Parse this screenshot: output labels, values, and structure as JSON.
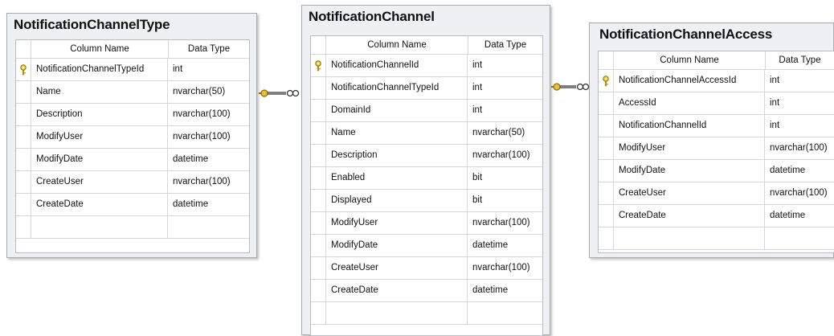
{
  "headers": {
    "column_name": "Column Name",
    "data_type": "Data Type"
  },
  "tables": [
    {
      "name": "NotificationChannelType",
      "columns": [
        {
          "name": "NotificationChannelTypeId",
          "type": "int",
          "key": true
        },
        {
          "name": "Name",
          "type": "nvarchar(50)",
          "key": false
        },
        {
          "name": "Description",
          "type": "nvarchar(100)",
          "key": false
        },
        {
          "name": "ModifyUser",
          "type": "nvarchar(100)",
          "key": false
        },
        {
          "name": "ModifyDate",
          "type": "datetime",
          "key": false
        },
        {
          "name": "CreateUser",
          "type": "nvarchar(100)",
          "key": false
        },
        {
          "name": "CreateDate",
          "type": "datetime",
          "key": false
        }
      ]
    },
    {
      "name": "NotificationChannel",
      "columns": [
        {
          "name": "NotificationChannelId",
          "type": "int",
          "key": true
        },
        {
          "name": "NotificationChannelTypeId",
          "type": "int",
          "key": false
        },
        {
          "name": "DomainId",
          "type": "int",
          "key": false
        },
        {
          "name": "Name",
          "type": "nvarchar(50)",
          "key": false
        },
        {
          "name": "Description",
          "type": "nvarchar(100)",
          "key": false
        },
        {
          "name": "Enabled",
          "type": "bit",
          "key": false
        },
        {
          "name": "Displayed",
          "type": "bit",
          "key": false
        },
        {
          "name": "ModifyUser",
          "type": "nvarchar(100)",
          "key": false
        },
        {
          "name": "ModifyDate",
          "type": "datetime",
          "key": false
        },
        {
          "name": "CreateUser",
          "type": "nvarchar(100)",
          "key": false
        },
        {
          "name": "CreateDate",
          "type": "datetime",
          "key": false
        }
      ]
    },
    {
      "name": "NotificationChannelAccess",
      "columns": [
        {
          "name": "NotificationChannelAccessId",
          "type": "int",
          "key": true
        },
        {
          "name": "AccessId",
          "type": "int",
          "key": false
        },
        {
          "name": "NotificationChannelId",
          "type": "int",
          "key": false
        },
        {
          "name": "ModifyUser",
          "type": "nvarchar(100)",
          "key": false
        },
        {
          "name": "ModifyDate",
          "type": "datetime",
          "key": false
        },
        {
          "name": "CreateUser",
          "type": "nvarchar(100)",
          "key": false
        },
        {
          "name": "CreateDate",
          "type": "datetime",
          "key": false
        }
      ]
    }
  ],
  "relationships": [
    {
      "from": "NotificationChannelType",
      "to": "NotificationChannel",
      "one_end": "key-icon",
      "many_end": "infinity"
    },
    {
      "from": "NotificationChannel",
      "to": "NotificationChannelAccess",
      "one_end": "key-icon",
      "many_end": "infinity"
    }
  ],
  "colors": {
    "key": "#d4a017",
    "border": "#a7abb2",
    "panel": "#eef0f3"
  }
}
